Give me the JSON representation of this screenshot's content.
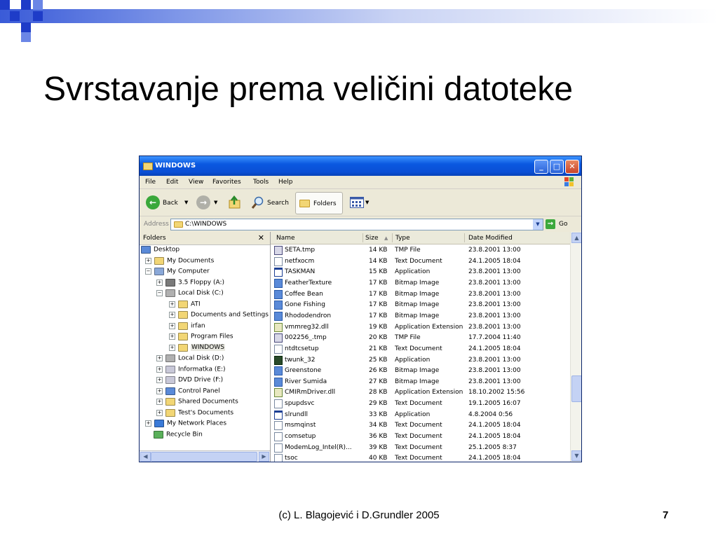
{
  "slide": {
    "title": "Svrstavanje prema veličini datoteke",
    "footer": "(c) L. Blagojević i D.Grundler 2005",
    "page_number": "7",
    "accent_color": "#3a5bd8"
  },
  "window": {
    "title": "WINDOWS",
    "menu": [
      "File",
      "Edit",
      "View",
      "Favorites",
      "Tools",
      "Help"
    ],
    "toolbar": {
      "back_label": "Back",
      "search_label": "Search",
      "folders_label": "Folders"
    },
    "address": {
      "label": "Address",
      "value": "C:\\WINDOWS",
      "go_label": "Go"
    },
    "folders_pane": {
      "title": "Folders",
      "close_glyph": "✕",
      "tree": [
        {
          "label": "Desktop",
          "expander": "",
          "icon": "desktop"
        },
        {
          "label": "My Documents",
          "expander": "+",
          "icon": "folder"
        },
        {
          "label": "My Computer",
          "expander": "−",
          "icon": "computer"
        },
        {
          "label": "3.5 Floppy (A:)",
          "expander": "+",
          "icon": "floppy"
        },
        {
          "label": "Local Disk (C:)",
          "expander": "−",
          "icon": "disk"
        },
        {
          "label": "ATI",
          "expander": "+",
          "icon": "folder"
        },
        {
          "label": "Documents and Settings",
          "expander": "+",
          "icon": "folder"
        },
        {
          "label": "irfan",
          "expander": "+",
          "icon": "folder"
        },
        {
          "label": "Program Files",
          "expander": "+",
          "icon": "folder"
        },
        {
          "label": "WINDOWS",
          "expander": "+",
          "icon": "folder-open"
        },
        {
          "label": "Local Disk (D:)",
          "expander": "+",
          "icon": "disk"
        },
        {
          "label": "Informatka (E:)",
          "expander": "+",
          "icon": "cd"
        },
        {
          "label": "DVD Drive (F:)",
          "expander": "+",
          "icon": "dvd"
        },
        {
          "label": "Control Panel",
          "expander": "+",
          "icon": "control-panel"
        },
        {
          "label": "Shared Documents",
          "expander": "+",
          "icon": "folder"
        },
        {
          "label": "Test's Documents",
          "expander": "+",
          "icon": "folder"
        },
        {
          "label": "My Network Places",
          "expander": "+",
          "icon": "network"
        },
        {
          "label": "Recycle Bin",
          "expander": "",
          "icon": "recycle"
        }
      ]
    },
    "file_list": {
      "columns": [
        "Name",
        "Size",
        "Type",
        "Date Modified"
      ],
      "sort_indicator": "▲",
      "rows": [
        {
          "name": "SETA.tmp",
          "size": "14 KB",
          "type": "TMP File",
          "date": "23.8.2001 13:00",
          "icon": "tmp"
        },
        {
          "name": "netfxocm",
          "size": "14 KB",
          "type": "Text Document",
          "date": "24.1.2005 18:04",
          "icon": "txt"
        },
        {
          "name": "TASKMAN",
          "size": "15 KB",
          "type": "Application",
          "date": "23.8.2001 13:00",
          "icon": "app"
        },
        {
          "name": "FeatherTexture",
          "size": "17 KB",
          "type": "Bitmap Image",
          "date": "23.8.2001 13:00",
          "icon": "bmp"
        },
        {
          "name": "Coffee Bean",
          "size": "17 KB",
          "type": "Bitmap Image",
          "date": "23.8.2001 13:00",
          "icon": "bmp"
        },
        {
          "name": "Gone Fishing",
          "size": "17 KB",
          "type": "Bitmap Image",
          "date": "23.8.2001 13:00",
          "icon": "bmp"
        },
        {
          "name": "Rhododendron",
          "size": "17 KB",
          "type": "Bitmap Image",
          "date": "23.8.2001 13:00",
          "icon": "bmp"
        },
        {
          "name": "vmmreg32.dll",
          "size": "19 KB",
          "type": "Application Extension",
          "date": "23.8.2001 13:00",
          "icon": "dll"
        },
        {
          "name": "002256_.tmp",
          "size": "20 KB",
          "type": "TMP File",
          "date": "17.7.2004 11:40",
          "icon": "tmp"
        },
        {
          "name": "ntdtcsetup",
          "size": "21 KB",
          "type": "Text Document",
          "date": "24.1.2005 18:04",
          "icon": "txt"
        },
        {
          "name": "twunk_32",
          "size": "25 KB",
          "type": "Application",
          "date": "23.8.2001 13:00",
          "icon": "exe"
        },
        {
          "name": "Greenstone",
          "size": "26 KB",
          "type": "Bitmap Image",
          "date": "23.8.2001 13:00",
          "icon": "bmp"
        },
        {
          "name": "River Sumida",
          "size": "27 KB",
          "type": "Bitmap Image",
          "date": "23.8.2001 13:00",
          "icon": "bmp"
        },
        {
          "name": "CMIRmDriver.dll",
          "size": "28 KB",
          "type": "Application Extension",
          "date": "18.10.2002 15:56",
          "icon": "dll"
        },
        {
          "name": "spupdsvc",
          "size": "29 KB",
          "type": "Text Document",
          "date": "19.1.2005 16:07",
          "icon": "txt"
        },
        {
          "name": "slrundll",
          "size": "33 KB",
          "type": "Application",
          "date": "4.8.2004 0:56",
          "icon": "app"
        },
        {
          "name": "msmqinst",
          "size": "34 KB",
          "type": "Text Document",
          "date": "24.1.2005 18:04",
          "icon": "txt"
        },
        {
          "name": "comsetup",
          "size": "36 KB",
          "type": "Text Document",
          "date": "24.1.2005 18:04",
          "icon": "txt"
        },
        {
          "name": "ModemLog_Intel(R)...",
          "size": "39 KB",
          "type": "Text Document",
          "date": "25.1.2005 8:37",
          "icon": "txt"
        },
        {
          "name": "tsoc",
          "size": "40 KB",
          "type": "Text Document",
          "date": "24.1.2005 18:04",
          "icon": "txt"
        }
      ]
    }
  }
}
